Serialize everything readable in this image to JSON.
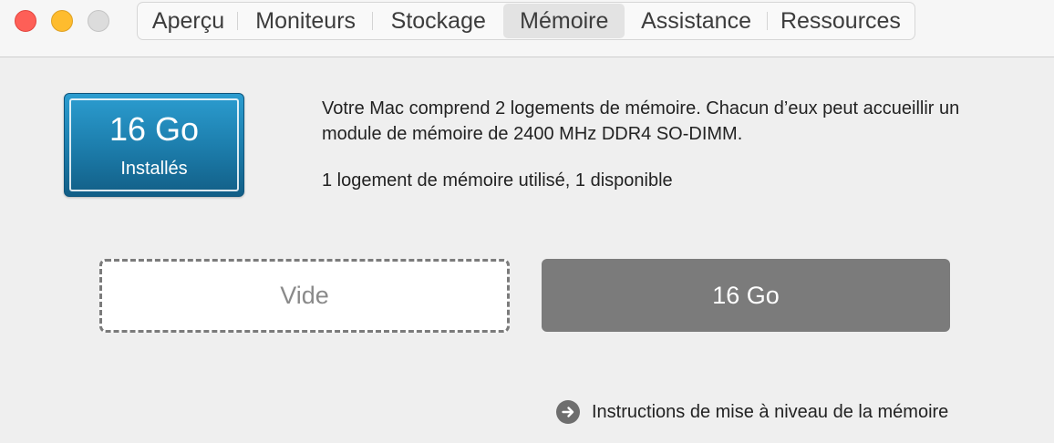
{
  "window": {
    "title": ""
  },
  "tabs": [
    {
      "label": "Aperçu",
      "active": false
    },
    {
      "label": "Moniteurs",
      "active": false
    },
    {
      "label": "Stockage",
      "active": false
    },
    {
      "label": "Mémoire",
      "active": true
    },
    {
      "label": "Assistance",
      "active": false
    },
    {
      "label": "Ressources",
      "active": false
    }
  ],
  "memory": {
    "badge": {
      "size": "16 Go",
      "status": "Installés"
    },
    "description": "Votre Mac comprend 2 logements de mémoire. Chacun d’eux peut accueillir un module de mémoire de 2400 MHz DDR4 SO-DIMM.",
    "usage": "1 logement de mémoire utilisé, 1 disponible",
    "slots": [
      {
        "label": "Vide",
        "state": "empty"
      },
      {
        "label": "16 Go",
        "state": "filled"
      }
    ],
    "upgrade_link": "Instructions de mise à niveau de la mémoire"
  },
  "colors": {
    "badge_blue": "#1d7fae",
    "slot_filled": "#7b7b7b",
    "close": "#fe5f57",
    "minimize": "#febc2e",
    "zoom_disabled": "#dcdcdc"
  },
  "icons": {
    "close": "close-button",
    "minimize": "minimize-button",
    "zoom": "zoom-button",
    "link": "arrow-right-circle-icon"
  }
}
